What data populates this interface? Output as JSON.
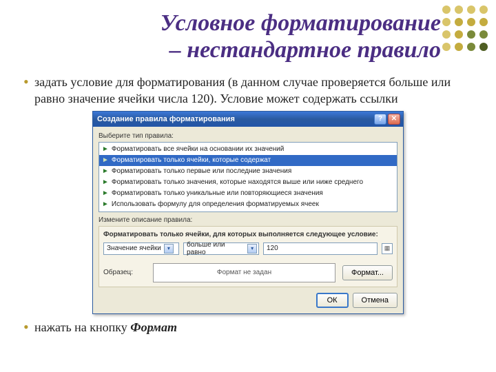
{
  "title_line1": "Условное форматирование",
  "title_line2": "– нестандартное правило",
  "bullet1": "задать условие для форматирования (в данном случае проверяется больше или равно значение ячейки числа 120). Условие может содержать ссылки",
  "bullet2_prefix": "нажать на кнопку ",
  "bullet2_em": "Формат",
  "dots": [
    "#d9c56a",
    "#d9c56a",
    "#d9c56a",
    "#d9c56a",
    "#d9c56a",
    "#c4ac3f",
    "#c4ac3f",
    "#c4ac3f",
    "#d9c56a",
    "#c4ac3f",
    "#7a8a3a",
    "#7a8a3a",
    "#d9c56a",
    "#c4ac3f",
    "#7a8a3a",
    "#4f5e23"
  ],
  "dialog": {
    "title": "Создание правила форматирования",
    "section1_label": "Выберите тип правила:",
    "rules": [
      "Форматировать все ячейки на основании их значений",
      "Форматировать только ячейки, которые содержат",
      "Форматировать только первые или последние значения",
      "Форматировать только значения, которые находятся выше или ниже среднего",
      "Форматировать только уникальные или повторяющиеся значения",
      "Использовать формулу для определения форматируемых ячеек"
    ],
    "selected_rule_index": 1,
    "section2_label": "Измените описание правила:",
    "panel_title": "Форматировать только ячейки, для которых выполняется следующее условие:",
    "sel1": "Значение ячейки",
    "sel2": "больше или равно",
    "value": "120",
    "sample_label": "Образец:",
    "sample_text": "Формат не задан",
    "format_btn": "Формат...",
    "ok": "ОК",
    "cancel": "Отмена"
  }
}
